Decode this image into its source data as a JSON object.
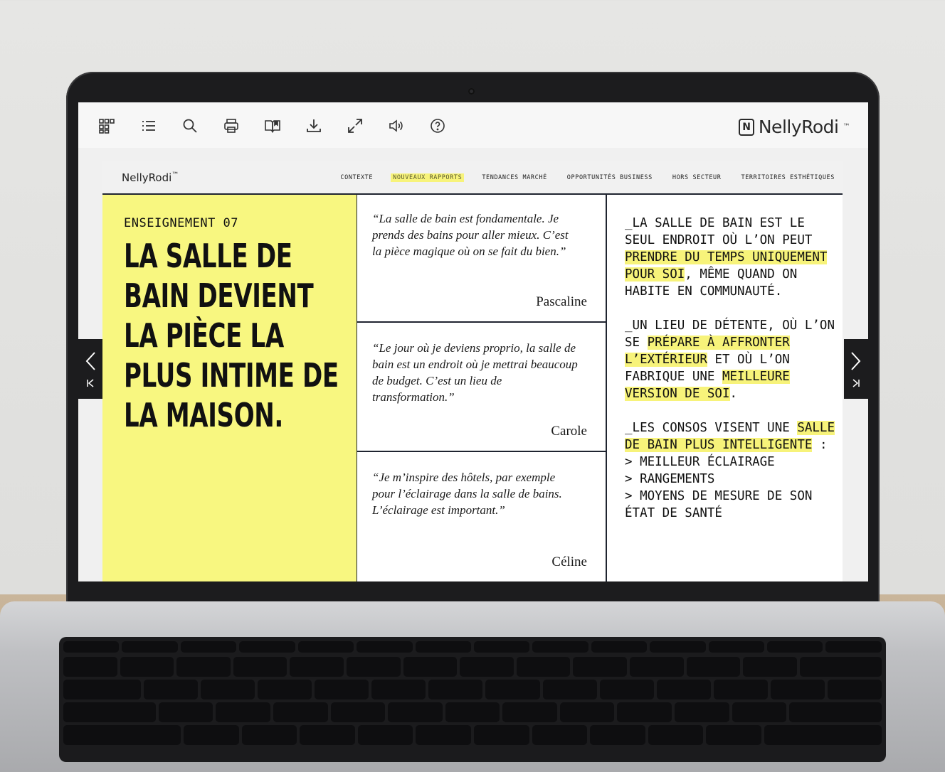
{
  "toolbar": {
    "icons": [
      "grid-icon",
      "list-icon",
      "search-icon",
      "print-icon",
      "book-icon",
      "download-icon",
      "fullscreen-icon",
      "audio-icon",
      "help-icon"
    ],
    "brand": "NellyRodi",
    "brand_tm": "™"
  },
  "nav": {
    "logo": "NellyRodi",
    "logo_tm": "™",
    "links": [
      {
        "label": "CONTEXTE"
      },
      {
        "label": "NOUVEAUX RAPPORTS"
      },
      {
        "label": "TENDANCES MARCHÉ"
      },
      {
        "label": "OPPORTUNITÉS BUSINESS"
      },
      {
        "label": "HORS SECTEUR"
      },
      {
        "label": "TERRITOIRES ESTHÉTIQUES"
      }
    ],
    "active_index": 1
  },
  "hero": {
    "kicker": "ENSEIGNEMENT 07",
    "title": "LA SALLE DE BAIN DEVIENT LA PIÈCE LA PLUS INTIME DE LA MAISON."
  },
  "quotes": [
    {
      "text": "“La salle de bain est fondamentale. Je prends des bains pour aller mieux. C’est la pièce magique où on se fait du bien.”",
      "author": "Pascaline"
    },
    {
      "text": "“Le jour où je deviens proprio, la salle de bain est un endroit où je mettrai beaucoup de budget. C’est un lieu de transformation.”",
      "author": "Carole"
    },
    {
      "text": "“Je m’inspire des hôtels, par exemple pour l’éclairage dans la salle de bains. L’éclairage est important.”",
      "author": "Céline"
    }
  ],
  "insights": {
    "p1": {
      "a": "_LA SALLE DE BAIN EST LE SEUL ENDROIT OÙ L’ON PEUT ",
      "hl": "PRENDRE DU TEMPS UNIQUEMENT POUR SOI",
      "b": ", MÊME QUAND ON HABITE EN COMMUNAUTÉ."
    },
    "p2": {
      "a": "_UN LIEU DE DÉTENTE, OÙ L’ON SE ",
      "hl1": "PRÉPARE À AFFRONTER L’EXTÉRIEUR",
      "b": " ET OÙ L’ON FABRIQUE UNE ",
      "hl2": "MEILLEURE VERSION DE SOI",
      "c": "."
    },
    "p3": {
      "a": "_LES CONSOS VISENT UNE ",
      "hl": "SALLE DE BAIN PLUS INTELLIGENTE",
      "b": " :"
    },
    "list": [
      "> MEILLEUR ÉCLAIRAGE",
      "> RANGEMENTS",
      "> MOYENS DE MESURE DE SON ÉTAT DE SANTÉ"
    ]
  }
}
